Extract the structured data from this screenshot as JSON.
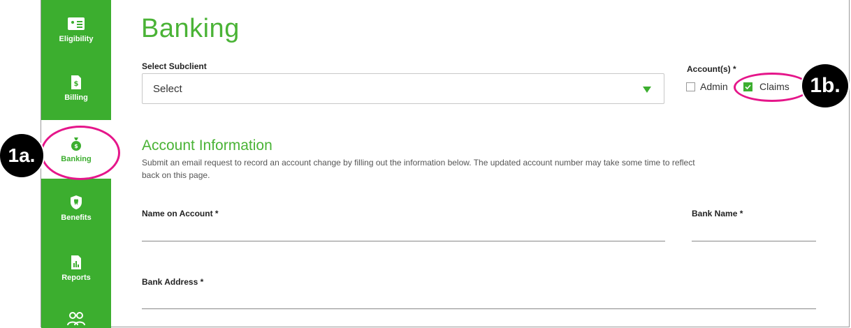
{
  "page": {
    "title": "Banking"
  },
  "sidebar": {
    "items": [
      {
        "label": "Eligibility",
        "icon": "id-card-icon"
      },
      {
        "label": "Billing",
        "icon": "dollar-document-icon"
      },
      {
        "label": "Banking",
        "icon": "money-bag-icon",
        "active": true
      },
      {
        "label": "Benefits",
        "icon": "tooth-shield-icon"
      },
      {
        "label": "Reports",
        "icon": "report-icon"
      },
      {
        "label": "",
        "icon": "users-icon"
      }
    ]
  },
  "subclient": {
    "label": "Select Subclient",
    "value": "Select"
  },
  "accounts": {
    "label": "Account(s) *",
    "options": [
      {
        "label": "Admin",
        "checked": false
      },
      {
        "label": "Claims",
        "checked": true
      }
    ]
  },
  "account_info": {
    "title": "Account Information",
    "description": "Submit an email request to record an account change by filling out the information below. The updated account number may take some time to reflect back on this page."
  },
  "fields": {
    "name_on_account": "Name on Account *",
    "bank_name": "Bank Name *",
    "bank_address": "Bank Address *"
  },
  "annotations": {
    "callout_1a": "1a.",
    "callout_1b": "1b."
  },
  "colors": {
    "brand_green": "#3cae2f",
    "annotation_pink": "#e5168a"
  }
}
